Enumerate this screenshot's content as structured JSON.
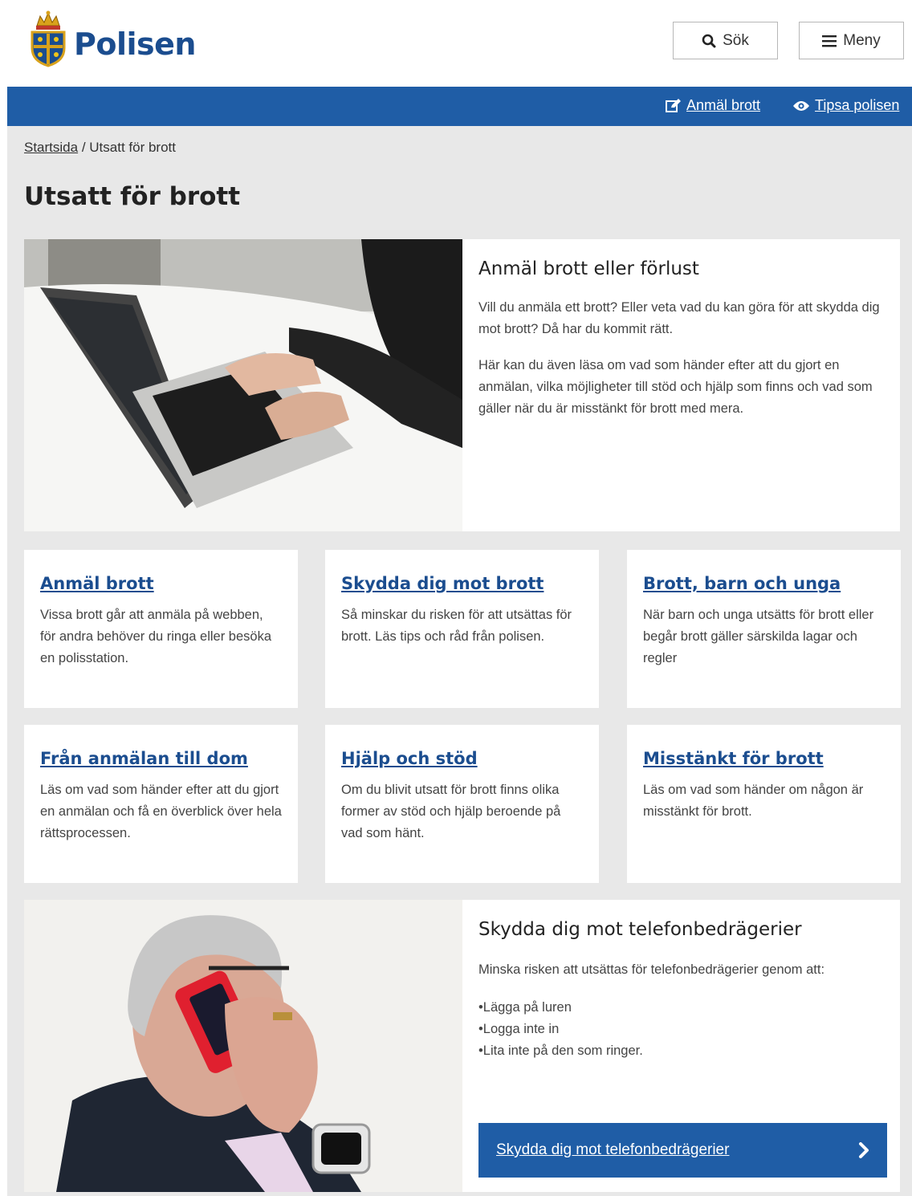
{
  "header": {
    "logo_text": "Polisen",
    "search_label": "Sök",
    "menu_label": "Meny"
  },
  "toplinks": {
    "report_label": "Anmäl brott",
    "tip_label": "Tipsa polisen"
  },
  "breadcrumb": {
    "home": "Startsida",
    "separator": " / ",
    "current": "Utsatt för brott"
  },
  "page_title": "Utsatt för brott",
  "hero": {
    "title": "Anmäl brott eller förlust",
    "paragraphs": [
      "Vill du anmäla ett brott? Eller veta vad du kan göra för att skydda dig mot brott? Då har du kommit rätt.",
      "Här kan du även läsa om vad som händer efter att du gjort en anmälan, vilka möjligheter till stöd och hjälp som finns och vad som gäller när du är misstänkt för brott med mera."
    ]
  },
  "cards": [
    {
      "title": "Anmäl brott",
      "text": "Vissa brott går att anmäla på webben, för andra behöver du ringa eller besöka en polisstation."
    },
    {
      "title": "Skydda dig mot brott",
      "text": "Så minskar du risken för att utsättas för brott. Läs tips och råd från polisen."
    },
    {
      "title": "Brott, barn och unga",
      "text": "När barn och unga utsätts för brott eller begår brott gäller särskilda lagar och regler"
    },
    {
      "title": "Från anmälan till dom",
      "text": "Läs om vad som händer efter att du gjort en anmälan och få en överblick över hela rättsprocessen."
    },
    {
      "title": "Hjälp och stöd",
      "text": "Om du blivit utsatt för brott finns olika former av stöd och hjälp beroende på vad som hänt."
    },
    {
      "title": "Misstänkt för brott",
      "text": "Läs om vad som händer om någon är misstänkt för brott."
    }
  ],
  "promo": {
    "title": "Skydda dig mot telefonbedrägerier",
    "intro": "Minska risken att utsättas för telefonbedrägerier genom att:",
    "bullets": [
      "Lägga på luren",
      "Logga inte in",
      "Lita inte på den som ringer."
    ],
    "button_label": "Skydda dig mot telefonbedrägerier"
  },
  "colors": {
    "brand_blue": "#1f5da6",
    "link_blue": "#1b4d8f",
    "background_gray": "#e8e8e8"
  },
  "icons": {
    "search": "search-icon",
    "menu": "menu-icon",
    "report": "edit-icon",
    "tip": "eye-icon",
    "chevron": "chevron-right-icon"
  }
}
